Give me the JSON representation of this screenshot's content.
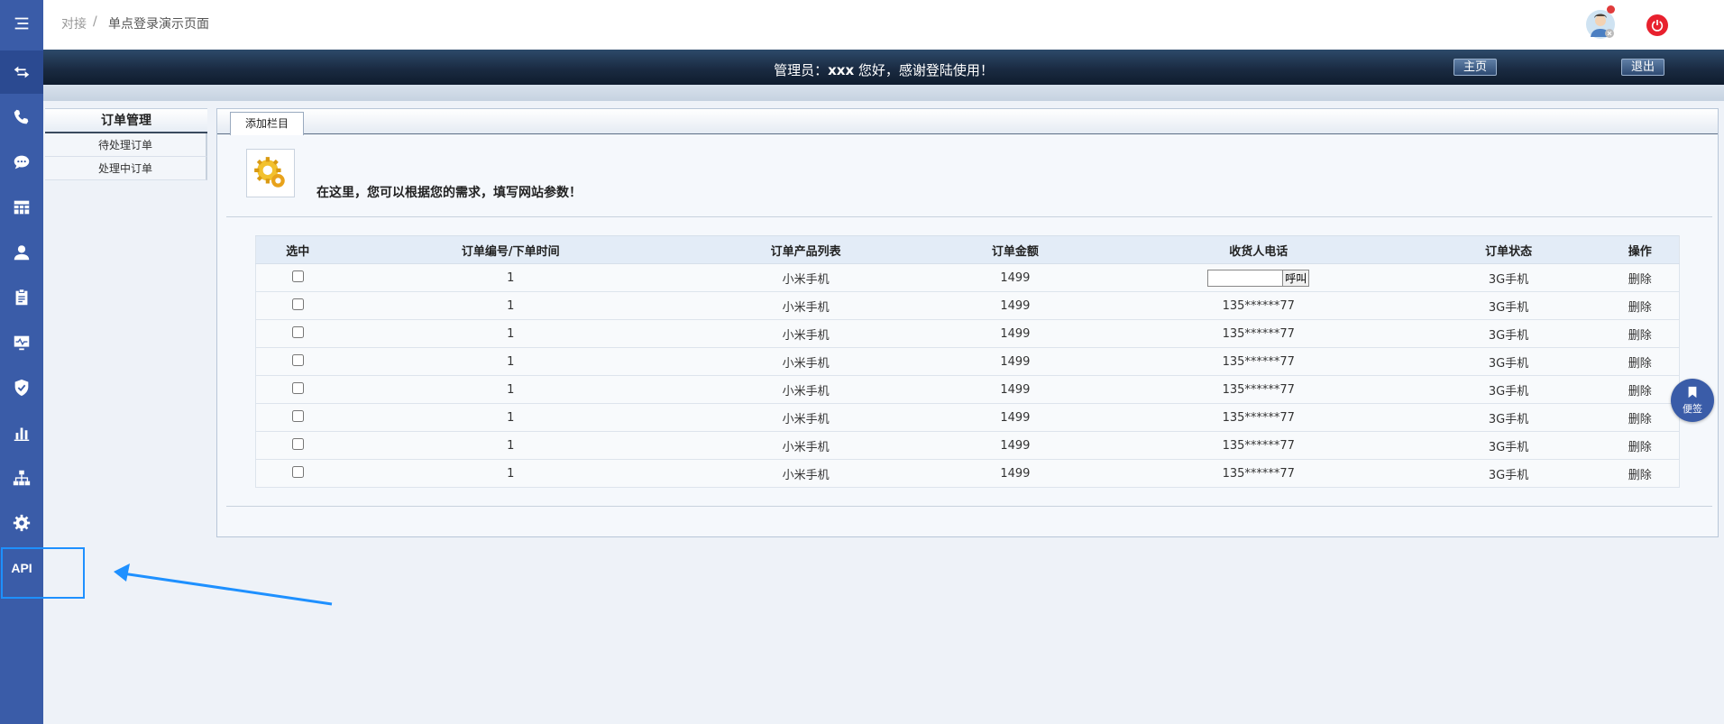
{
  "breadcrumb": {
    "parent": "对接",
    "separator": "/",
    "current": "单点登录演示页面"
  },
  "header": {
    "admin_label": "管理员：",
    "admin_name": "xxx",
    "welcome_text": " 您好，感谢登陆使用！",
    "home_button": "主页",
    "logout_button": "退出"
  },
  "rail": {
    "icons": [
      "menu-icon",
      "transfer-icon",
      "phone-icon",
      "chat-icon",
      "table-icon",
      "user-icon",
      "clipboard-icon",
      "monitor-icon",
      "shield-icon",
      "bar-chart-icon",
      "org-chart-icon",
      "gear-icon"
    ],
    "api_label": "API"
  },
  "submenu": {
    "title": "订单管理",
    "items": [
      {
        "label": "待处理订单"
      },
      {
        "label": "处理中订单"
      }
    ]
  },
  "panel": {
    "tab_label": "添加栏目",
    "intro_text": "在这里，您可以根据您的需求，填写网站参数！"
  },
  "table": {
    "headers": [
      "选中",
      "订单编号/下单时间",
      "订单产品列表",
      "订单金额",
      "收货人电话",
      "订单状态",
      "操作"
    ],
    "call_button": "呼叫",
    "rows": [
      {
        "order": "1",
        "product": "小米手机",
        "amount": "1499",
        "phone": "",
        "status": "3G手机",
        "action": "删除"
      },
      {
        "order": "1",
        "product": "小米手机",
        "amount": "1499",
        "phone": "135******77",
        "status": "3G手机",
        "action": "删除"
      },
      {
        "order": "1",
        "product": "小米手机",
        "amount": "1499",
        "phone": "135******77",
        "status": "3G手机",
        "action": "删除"
      },
      {
        "order": "1",
        "product": "小米手机",
        "amount": "1499",
        "phone": "135******77",
        "status": "3G手机",
        "action": "删除"
      },
      {
        "order": "1",
        "product": "小米手机",
        "amount": "1499",
        "phone": "135******77",
        "status": "3G手机",
        "action": "删除"
      },
      {
        "order": "1",
        "product": "小米手机",
        "amount": "1499",
        "phone": "135******77",
        "status": "3G手机",
        "action": "删除"
      },
      {
        "order": "1",
        "product": "小米手机",
        "amount": "1499",
        "phone": "135******77",
        "status": "3G手机",
        "action": "删除"
      },
      {
        "order": "1",
        "product": "小米手机",
        "amount": "1499",
        "phone": "135******77",
        "status": "3G手机",
        "action": "删除"
      }
    ]
  },
  "sticky_note": {
    "label": "便签"
  },
  "colors": {
    "rail": "#3a5ca8",
    "accent": "#1e90ff",
    "power": "#e8212e"
  }
}
